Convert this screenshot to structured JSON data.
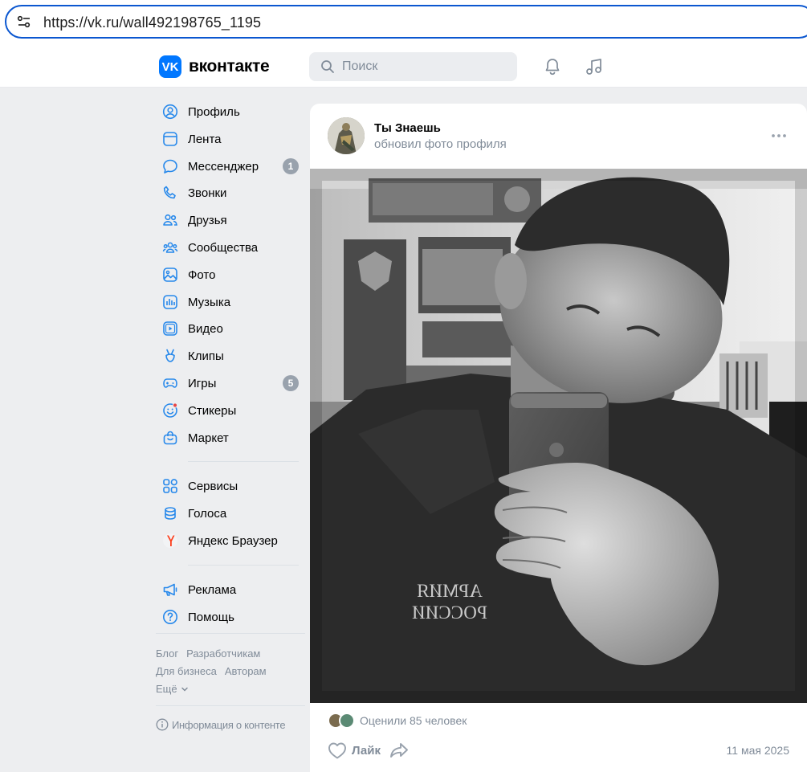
{
  "browser": {
    "url": "https://vk.ru/wall492198765_1195",
    "site_info_icon": "tune-icon"
  },
  "header": {
    "logo_text": "вконтакте",
    "logo_mark": "VK",
    "search_placeholder": "Поиск",
    "icons": [
      "bell-icon",
      "music-note-icon"
    ],
    "accent_color": "#0077ff"
  },
  "sidebar": {
    "items": [
      {
        "label": "Профиль",
        "icon": "profile-icon"
      },
      {
        "label": "Лента",
        "icon": "feed-icon"
      },
      {
        "label": "Мессенджер",
        "icon": "messenger-icon",
        "badge": "1"
      },
      {
        "label": "Звонки",
        "icon": "phone-icon"
      },
      {
        "label": "Друзья",
        "icon": "friends-icon"
      },
      {
        "label": "Сообщества",
        "icon": "communities-icon"
      },
      {
        "label": "Фото",
        "icon": "photo-icon"
      },
      {
        "label": "Музыка",
        "icon": "music-icon"
      },
      {
        "label": "Видео",
        "icon": "video-icon"
      },
      {
        "label": "Клипы",
        "icon": "clips-icon"
      },
      {
        "label": "Игры",
        "icon": "games-icon",
        "badge": "5"
      },
      {
        "label": "Стикеры",
        "icon": "stickers-icon"
      },
      {
        "label": "Маркет",
        "icon": "market-icon"
      }
    ],
    "items2": [
      {
        "label": "Сервисы",
        "icon": "services-icon"
      },
      {
        "label": "Голоса",
        "icon": "votes-icon"
      },
      {
        "label": "Яндекс Браузер",
        "icon": "yandex-browser-icon"
      }
    ],
    "items3": [
      {
        "label": "Реклама",
        "icon": "megaphone-icon"
      },
      {
        "label": "Помощь",
        "icon": "help-icon"
      }
    ],
    "footer": {
      "blog": "Блог",
      "developers": "Разработчикам",
      "business": "Для бизнеса",
      "authors": "Авторам",
      "more": "Ещё"
    },
    "content_info": "Информация о контенте"
  },
  "post": {
    "author": "Ты Знаешь",
    "action": "обновил фото профиля",
    "photo_shirt_text_line1": "АРМИЯ",
    "photo_shirt_text_line2": "РОССИИ",
    "likes_text": "Оценили 85 человек",
    "like_label": "Лайк",
    "date": "11 мая 2025"
  }
}
